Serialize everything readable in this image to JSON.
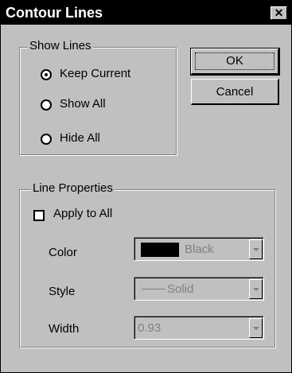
{
  "window": {
    "title": "Contour Lines",
    "close_label": "✕"
  },
  "show_lines": {
    "legend": "Show Lines",
    "options": [
      {
        "label": "Keep Current",
        "selected": true
      },
      {
        "label": "Show All",
        "selected": false
      },
      {
        "label": "Hide All",
        "selected": false
      }
    ]
  },
  "buttons": {
    "ok": "OK",
    "cancel": "Cancel"
  },
  "line_properties": {
    "legend": "Line Properties",
    "apply_to_all": "Apply to All",
    "color_label": "Color",
    "color_value": "Black",
    "style_label": "Style",
    "style_value": "Solid",
    "width_label": "Width",
    "width_value": "0.93"
  },
  "colors": {
    "dialog_bg": "#c0c0c0",
    "title_bg": "#000000",
    "disabled_text": "#808080"
  }
}
